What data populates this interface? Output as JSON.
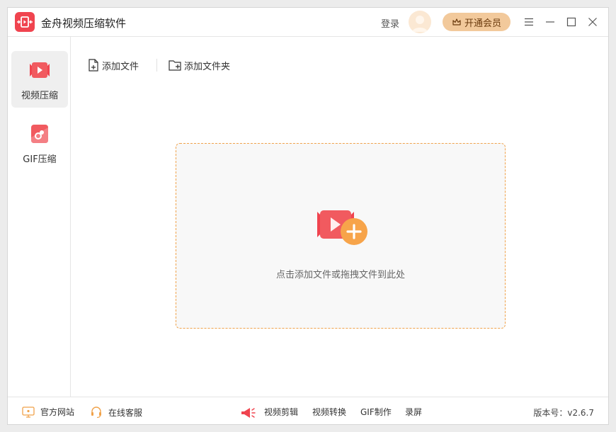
{
  "app": {
    "title": "金舟视频压缩软件"
  },
  "header": {
    "login_label": "登录",
    "vip_label": "开通会员"
  },
  "sidebar": {
    "items": [
      {
        "label": "视频压缩",
        "icon": "video-compress-icon",
        "active": true
      },
      {
        "label": "GIF压缩",
        "icon": "gif-compress-icon",
        "active": false
      }
    ]
  },
  "toolbar": {
    "add_file_label": "添加文件",
    "add_folder_label": "添加文件夹"
  },
  "dropzone": {
    "hint": "点击添加文件或拖拽文件到此处"
  },
  "footer": {
    "official_site": "官方网站",
    "customer_service": "在线客服",
    "links": [
      "视频剪辑",
      "视频转换",
      "GIF制作",
      "录屏"
    ],
    "version": "版本号：v2.6.7"
  },
  "colors": {
    "accent": "#f0444f",
    "vip": "#f2c99b",
    "dropzone_border": "#f0a24a"
  }
}
